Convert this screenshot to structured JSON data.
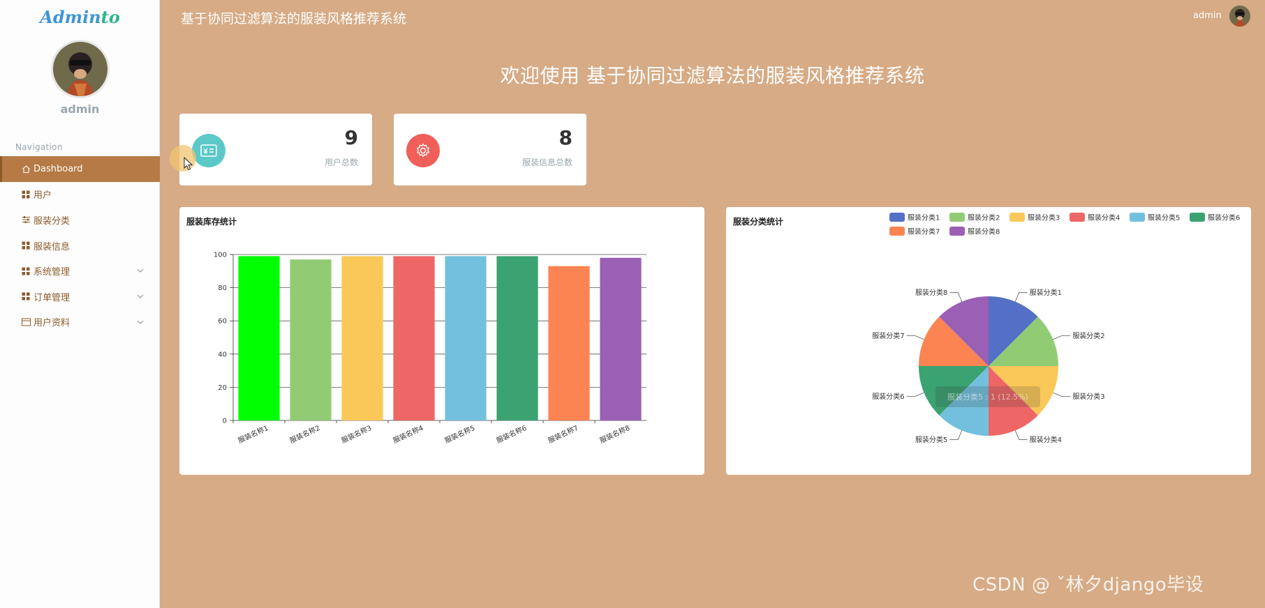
{
  "app": {
    "logo_prefix": "Admin",
    "logo_suffix": "to",
    "title": "基于协同过滤算法的服装风格推荐系统"
  },
  "sidebar": {
    "username": "admin",
    "nav_title": "Navigation",
    "items": [
      {
        "label": "Dashboard",
        "icon": "home-icon",
        "expandable": false,
        "active": true
      },
      {
        "label": "用户",
        "icon": "grid-icon",
        "expandable": false,
        "active": false
      },
      {
        "label": "服装分类",
        "icon": "sliders-icon",
        "expandable": false,
        "active": false
      },
      {
        "label": "服装信息",
        "icon": "grid-icon",
        "expandable": false,
        "active": false
      },
      {
        "label": "系统管理",
        "icon": "grid-icon",
        "expandable": true,
        "active": false
      },
      {
        "label": "订单管理",
        "icon": "grid-icon",
        "expandable": true,
        "active": false
      },
      {
        "label": "用户资料",
        "icon": "card-icon",
        "expandable": true,
        "active": false
      }
    ]
  },
  "header": {
    "title": "基于协同过滤算法的服装风格推荐系统",
    "username": "admin"
  },
  "welcome": "欢迎使用 基于协同过滤算法的服装风格推荐系统",
  "stats": [
    {
      "value": "9",
      "label": "用户总数",
      "icon": "id-card-icon",
      "color": "#5cc8c8"
    },
    {
      "value": "8",
      "label": "服装信息总数",
      "icon": "gear-icon",
      "color": "#f05f59"
    }
  ],
  "colors": {
    "background": "#d6ab85",
    "sidebar_active": "#b57a45",
    "nav_text": "#8b5a2b"
  },
  "chart_data": [
    {
      "type": "bar",
      "title": "服装库存统计",
      "categories": [
        "服装名称1",
        "服装名称2",
        "服装名称3",
        "服装名称4",
        "服装名称5",
        "服装名称6",
        "服装名称7",
        "服装名称8"
      ],
      "values": [
        99,
        97,
        99,
        99,
        99,
        99,
        93,
        98
      ],
      "colors": [
        "#00ff00",
        "#91cc75",
        "#fac858",
        "#ee6666",
        "#73c0de",
        "#3ba272",
        "#fc8452",
        "#9a60b4"
      ],
      "ylim": [
        0,
        100
      ],
      "yticks": [
        0,
        20,
        40,
        60,
        80,
        100
      ],
      "grid": true
    },
    {
      "type": "pie",
      "title": "服装分类统计",
      "categories": [
        "服装分类1",
        "服装分类2",
        "服装分类3",
        "服装分类4",
        "服装分类5",
        "服装分类6",
        "服装分类7",
        "服装分类8"
      ],
      "values": [
        1,
        1,
        1,
        1,
        1,
        1,
        1,
        1
      ],
      "colors": [
        "#5470c6",
        "#91cc75",
        "#fac858",
        "#ee6666",
        "#73c0de",
        "#3ba272",
        "#fc8452",
        "#9a60b4"
      ],
      "legend_position": "top-right",
      "tooltip": "服装分类5 : 1 (12.5%)"
    }
  ],
  "watermark": "CSDN @ ˇ林夕django毕设"
}
